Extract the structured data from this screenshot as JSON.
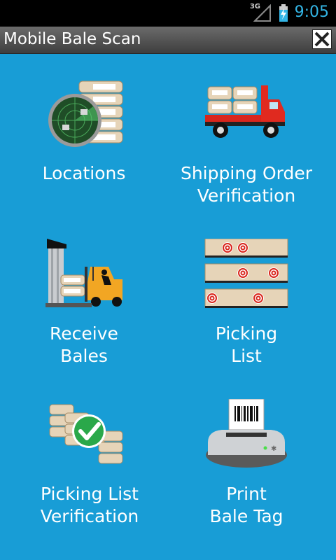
{
  "status_bar": {
    "network": "3G",
    "time": "9:05",
    "icons": [
      "signal-icon",
      "battery-charging-icon"
    ]
  },
  "header": {
    "title": "Mobile Bale Scan",
    "close_icon": "close-icon"
  },
  "menu": [
    {
      "label": "Locations",
      "icon": "radar-bales-icon"
    },
    {
      "label": "Shipping Order\nVerification",
      "icon": "truck-bales-icon"
    },
    {
      "label": "Receive\nBales",
      "icon": "forklift-icon"
    },
    {
      "label": "Picking\nList",
      "icon": "bale-racks-icon"
    },
    {
      "label": "Picking List\nVerification",
      "icon": "bales-checkmark-icon"
    },
    {
      "label": "Print\nBale Tag",
      "icon": "barcode-printer-icon"
    }
  ],
  "colors": {
    "background": "#189dd6",
    "status_time": "#33b5e5",
    "title_bar": "#4a4a4a"
  }
}
